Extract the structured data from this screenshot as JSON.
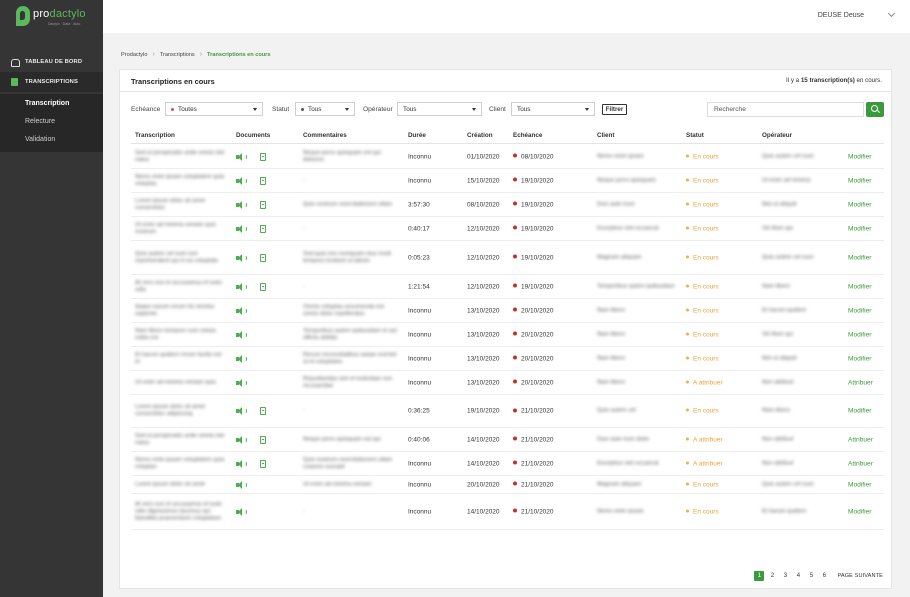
{
  "sidebar": {
    "logo": {
      "pre": "pro",
      "post": "dactylo",
      "tagline": "Dactylo · Data · Auto"
    },
    "nav": [
      {
        "label": "TABLEAU DE BORD",
        "icon": "home-icon"
      },
      {
        "label": "TRANSCRIPTIONS",
        "icon": "transcription-icon"
      }
    ],
    "sub_items": [
      {
        "label": "Transcription",
        "active": true
      },
      {
        "label": "Relecture",
        "active": false
      },
      {
        "label": "Validation",
        "active": false
      }
    ]
  },
  "topbar": {
    "user_name": "DEUSE Deuse"
  },
  "breadcrumb": [
    "Prodactylo",
    "Transcriptions",
    "Transcriptions en cours"
  ],
  "card": {
    "title": "Transcriptions en cours",
    "count_prefix": "Il y a ",
    "count_bold": "15 transcription(s)",
    "count_suffix": " en cours."
  },
  "filters": {
    "echeance_label": "Echéance",
    "echeance_value": "Toutes",
    "statut_label": "Statut",
    "statut_value": "Tous",
    "operateur_label": "Opérateur",
    "operateur_value": "Tous",
    "client_label": "Client",
    "client_value": "Tous",
    "filter_button": "Filtrer",
    "search_placeholder": "Recherche"
  },
  "table": {
    "headers": {
      "transcription": "Transcription",
      "documents": "Documents",
      "commentaires": "Commentaires",
      "duree": "Durée",
      "creation": "Création",
      "echeance": "Echéance",
      "client": "Client",
      "statut": "Statut",
      "operateur": "Opérateur"
    },
    "rows": [
      {
        "transcription": "Sed ut perspiciatis unde omnis iste natus",
        "doc": true,
        "commentaires": "Neque porro quisquam est qui dolorem",
        "duree": "Inconnu",
        "creation": "01/10/2020",
        "echeance": "08/10/2020",
        "client": "Nemo enim ipsam",
        "statut": "En cours",
        "operateur": "Quis autem vel eum",
        "action": "Modifier"
      },
      {
        "transcription": "Nemo enim ipsam voluptatem quia voluptas",
        "doc": true,
        "commentaires": "-",
        "duree": "Inconnu",
        "creation": "15/10/2020",
        "echeance": "19/10/2020",
        "client": "Neque porro quisquam",
        "statut": "En cours",
        "operateur": "Ut enim ad minima",
        "action": "Modifier"
      },
      {
        "transcription": "Lorem ipsum dolor sit amet consectetur",
        "doc": true,
        "commentaires": "Quis nostrum exercitationem ullam",
        "duree": "3:57:30",
        "creation": "08/10/2020",
        "echeance": "19/10/2020",
        "client": "Duis aute irure",
        "statut": "En cours",
        "operateur": "Nisi ut aliquid",
        "action": "Modifier"
      },
      {
        "transcription": "Ut enim ad minima veniam quis nostrum",
        "doc": true,
        "commentaires": "-",
        "duree": "0:40:17",
        "creation": "12/10/2020",
        "echeance": "19/10/2020",
        "client": "Excepteur sint occaecat",
        "statut": "En cours",
        "operateur": "Vel illum qui",
        "action": "Modifier"
      },
      {
        "transcription": "Quis autem vel eum iure reprehenderit qui in ea voluptate",
        "doc": true,
        "commentaires": "Sed quia non numquam eius modi tempora incidunt ut labore",
        "duree": "0:05:23",
        "creation": "12/10/2020",
        "echeance": "19/10/2020",
        "client": "Magnam aliquam",
        "statut": "En cours",
        "operateur": "Quis autem vel eum",
        "action": "Modifier"
      },
      {
        "transcription": "At vero eos et accusamus et iusto odio",
        "doc": true,
        "commentaires": "-",
        "duree": "1:21:54",
        "creation": "12/10/2020",
        "echeance": "19/10/2020",
        "client": "Temporibus autem quibusdam",
        "statut": "En cours",
        "operateur": "Nam libero",
        "action": "Modifier"
      },
      {
        "transcription": "Itaque earum rerum hic tenetur sapiente",
        "doc": false,
        "commentaires": "Omnis voluptas assumenda est omnis dolor repellendus",
        "duree": "Inconnu",
        "creation": "13/10/2020",
        "echeance": "20/10/2020",
        "client": "Nam libero",
        "statut": "En cours",
        "operateur": "Et harum quidem",
        "action": "Modifier"
      },
      {
        "transcription": "Nam libero tempore cum soluta nobis est",
        "doc": false,
        "commentaires": "Temporibus autem quibusdam et aut officiis debitis",
        "duree": "Inconnu",
        "creation": "13/10/2020",
        "echeance": "20/10/2020",
        "client": "Nam libero",
        "statut": "En cours",
        "operateur": "Vel illum qui",
        "action": "Modifier"
      },
      {
        "transcription": "Et harum quidem rerum facilis est et",
        "doc": false,
        "commentaires": "Rerum necessitatibus saepe eveniet ut et voluptates",
        "duree": "Inconnu",
        "creation": "13/10/2020",
        "echeance": "20/10/2020",
        "client": "Nam libero",
        "statut": "En cours",
        "operateur": "Nisi ut aliquid",
        "action": "Modifier"
      },
      {
        "transcription": "Ut enim ad minima veniam quis",
        "doc": false,
        "commentaires": "Repudiandae sint et molestiae non recusandae",
        "duree": "Inconnu",
        "creation": "13/10/2020",
        "echeance": "20/10/2020",
        "client": "Nam libero",
        "statut": "A attribuer",
        "operateur": "Non attribué",
        "action": "Attribuer"
      },
      {
        "transcription": "Lorem ipsum dolor sit amet consectetur adipiscing",
        "doc": true,
        "commentaires": "-",
        "duree": "0:36:25",
        "creation": "19/10/2020",
        "echeance": "21/10/2020",
        "client": "Quis autem vel",
        "statut": "En cours",
        "operateur": "Nam libero",
        "action": "Modifier"
      },
      {
        "transcription": "Sed ut perspiciatis unde omnis iste natus",
        "doc": true,
        "commentaires": "Neque porro quisquam est qui",
        "duree": "0:40:06",
        "creation": "14/10/2020",
        "echeance": "21/10/2020",
        "client": "Duis aute irure dolor",
        "statut": "A attribuer",
        "operateur": "Non attribué",
        "action": "Attribuer"
      },
      {
        "transcription": "Nemo enim ipsam voluptatem quia voluptas",
        "doc": true,
        "commentaires": "Quis nostrum exercitationem ullam corporis suscipit",
        "duree": "Inconnu",
        "creation": "14/10/2020",
        "echeance": "21/10/2020",
        "client": "Excepteur sint occaecat",
        "statut": "A attribuer",
        "operateur": "Non attribué",
        "action": "Attribuer"
      },
      {
        "transcription": "Lorem ipsum dolor sit amet",
        "doc": false,
        "commentaires": "Ut enim ad minima veniam",
        "duree": "Inconnu",
        "creation": "20/10/2020",
        "echeance": "21/10/2020",
        "client": "Magnam aliquam",
        "statut": "En cours",
        "operateur": "Quis autem vel eum",
        "action": "Modifier"
      },
      {
        "transcription": "At vero eos et accusamus et iusto odio dignissimos ducimus qui blanditiis praesentium voluptatum",
        "doc": false,
        "commentaires": "-",
        "duree": "Inconnu",
        "creation": "14/10/2020",
        "echeance": "21/10/2020",
        "client": "Nemo enim ipsam",
        "statut": "En cours",
        "operateur": "Et harum quidem",
        "action": "Modifier"
      }
    ]
  },
  "pagination": {
    "pages": [
      "1",
      "2",
      "3",
      "4",
      "5",
      "6"
    ],
    "current": "1",
    "next_label": "PAGE SUIVANTE"
  },
  "colors": {
    "sidebar_bg": "#353535",
    "accent_green": "#3c9a3c",
    "status_orange": "#e8a33a",
    "deadline_red": "#c9302c"
  }
}
